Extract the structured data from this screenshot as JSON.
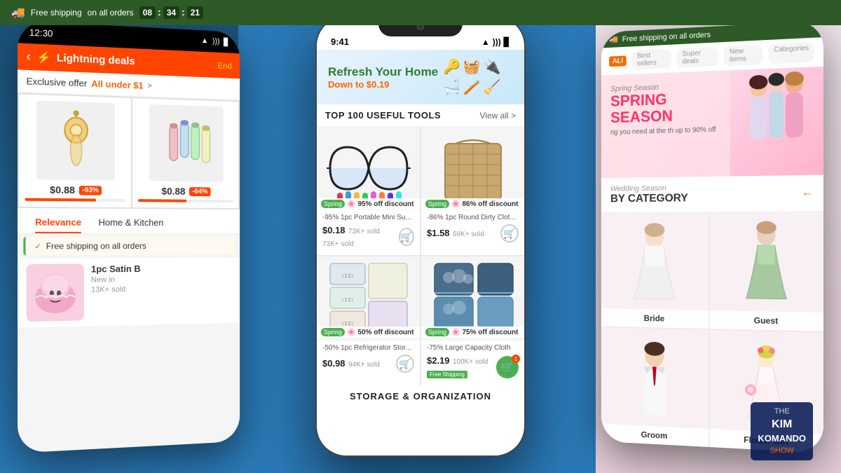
{
  "global": {
    "top_bar": {
      "shipping_text": "Free shipping",
      "shipping_sub": "on all orders",
      "timer": [
        "08",
        "34",
        "21"
      ]
    }
  },
  "left_phone": {
    "status_time": "12:30",
    "header": {
      "title": "Lightning deals",
      "end_label": "End"
    },
    "exclusive": {
      "label": "Exclusive offer",
      "price": "All under $1",
      "arrow": ">"
    },
    "products": [
      {
        "price": "$0.88",
        "discount": "-93%",
        "emoji": "👂",
        "progress": 70
      },
      {
        "price": "$0.88",
        "discount": "-64%",
        "emoji": "📎",
        "progress": 50
      }
    ],
    "tabs": [
      "Relevance",
      "Home & Kitchen"
    ],
    "shipping": "Free shipping on all orders",
    "list_item": {
      "img_emoji": "🎀",
      "title": "1pc Satin B",
      "subtitle": "New in",
      "sold": "13K+ sold"
    }
  },
  "center_phone": {
    "status_time": "9:41",
    "status_icons": "▲ ))) ▊",
    "banner": {
      "title": "Refresh Your Home",
      "subtitle": "Down to $0.19",
      "icons": [
        "🔑",
        "🧺",
        "🔌",
        "🛁",
        "🪥",
        "🧹"
      ]
    },
    "section_top100": {
      "title": "TOP 100 USEFUL TOOLS",
      "view_all": "View all >"
    },
    "products": [
      {
        "emoji": "🕶️",
        "discount_pct": "95% off discount",
        "spring": "Spring",
        "desc": "-95% 1pc Portable Mini Su...",
        "price": "$0.18",
        "sold": "73K+ sold",
        "cart": "🛒"
      },
      {
        "emoji": "🧺",
        "discount_pct": "86% off discount",
        "spring": "Spring",
        "desc": "-86% 1pc Round Dirty Clot...",
        "price": "$1.58",
        "sold": "69K+ sold",
        "cart": "🛒"
      },
      {
        "emoji": "📦",
        "discount_pct": "50% off discount",
        "spring": "Spring",
        "desc": "-50% 1pc Refrigerator Stor...",
        "price": "$0.98",
        "sold": "94K+ sold",
        "cart": "🛒"
      },
      {
        "emoji": "🗃️",
        "discount_pct": "75% off discount",
        "spring": "Spring",
        "desc": "-75% Large Capacity Cloth",
        "price": "$2.19",
        "sold": "100K+ sold",
        "cart": "🛒",
        "free_ship": "Free Shipping",
        "cart_green": true
      }
    ],
    "storage_section": {
      "title": "STORAGE & ORGANIZATION"
    }
  },
  "right_phone": {
    "top_notif": "Free shipping on all orders",
    "logo": "ALI",
    "nav": [
      "Best sellers",
      "Super deals",
      "New items",
      "Categories"
    ],
    "hero": {
      "season_small": "Spring Season",
      "title": "SPRING SEASON",
      "desc": "ng you need at the\nth up to 90% off",
      "emoji": "👗"
    },
    "wedding_section": {
      "label": "Wedding Season",
      "title": "BY CATEGORY",
      "arrow": "←"
    },
    "categories": [
      {
        "label": "Bride",
        "emoji": "👰"
      },
      {
        "label": "Guest",
        "emoji": "🥂"
      },
      {
        "label": "Groom",
        "emoji": "🤵"
      },
      {
        "label": "Flower Girl",
        "emoji": "👸"
      }
    ]
  },
  "watermark": {
    "line1": "THE",
    "line2": "KIM",
    "line3": "KOMANDO",
    "line4": "SHOW"
  }
}
